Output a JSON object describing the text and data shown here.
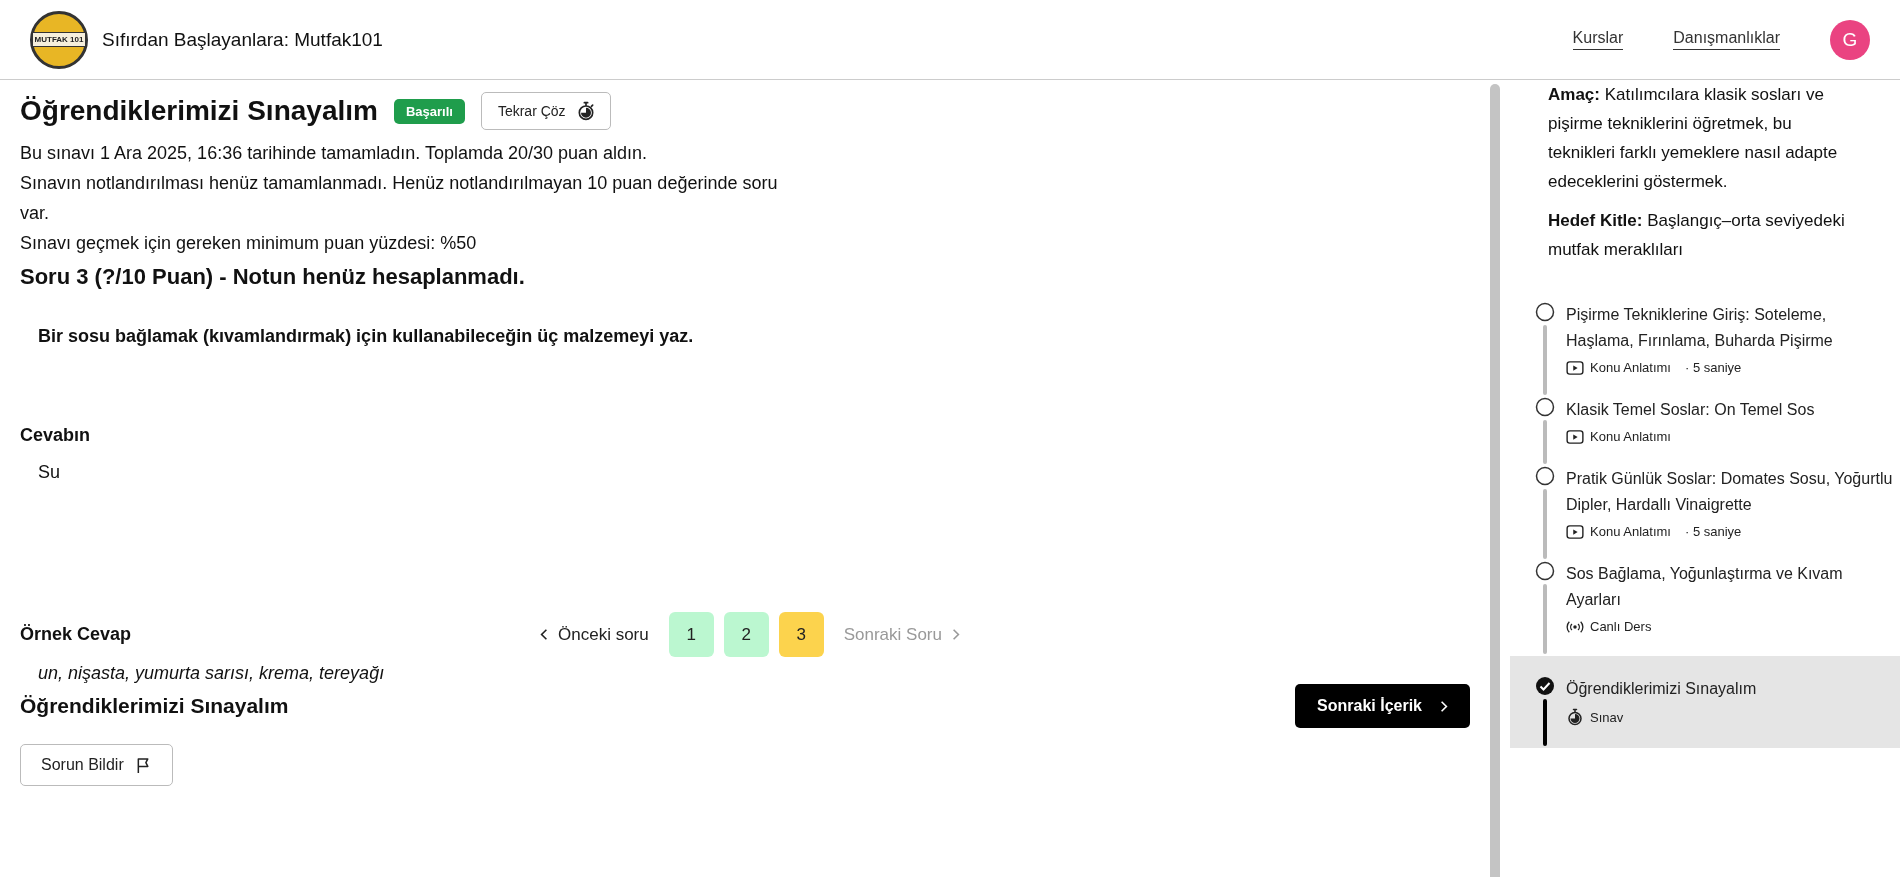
{
  "header": {
    "logo_text": "MUTFAK 101",
    "course_title": "Sıfırdan Başlayanlara: Mutfak101",
    "nav": [
      "Kurslar",
      "Danışmanlıklar"
    ],
    "avatar": "G"
  },
  "quiz": {
    "title": "Öğrendiklerimizi Sınayalım",
    "status_badge": "Başarılı",
    "retry_button": "Tekrar Çöz",
    "summary": [
      "Bu sınavı 1 Ara 2025, 16:36 tarihinde tamamladın. Toplamda 20/30 puan aldın.",
      "Sınavın notlandırılması henüz tamamlanmadı. Henüz notlandırılmayan 10 puan değerinde soru var.",
      "Sınavı geçmek için gereken minimum puan yüzdesi: %50"
    ],
    "question_heading": "Soru 3 (?/10 Puan) - Notun henüz hesaplanmadı.",
    "question": "Bir sosu bağlamak (kıvamlandırmak) için kullanabileceğin üç malzemeyi yaz.",
    "answer_label": "Cevabın",
    "answer": "Su",
    "sample_label": "Örnek Cevap",
    "sample_answer": "un, nişasta, yumurta sarısı, krema, tereyağı",
    "prev": {
      "label": "Önceki soru",
      "disabled": false
    },
    "pages": [
      {
        "label": "1",
        "selected": false
      },
      {
        "label": "2",
        "selected": false
      },
      {
        "label": "3",
        "selected": true
      }
    ],
    "next": {
      "label": "Sonraki Soru",
      "disabled": true
    }
  },
  "footer": {
    "title": "Öğrendiklerimizi Sınayalım",
    "next_content": "Sonraki İçerik",
    "report": "Sorun Bildir"
  },
  "sidebar": {
    "paragraphs": [
      "**Amaç:** Katılımcılara klasik sosları ve pişirme tekniklerini öğretmek, bu teknikleri farklı yemeklere nasıl adapte edeceklerini göstermek.",
      "**Hedef Kitle:** Başlangıç–orta seviyedeki mutfak meraklıları"
    ],
    "items": [
      {
        "title": "Pişirme Tekniklerine Giriş: Soteleme, Haşlama, Fırınlama, Buharda Pişirme",
        "kind": "video",
        "type": "Konu Anlatımı",
        "duration": "· 5 saniye",
        "selected": false
      },
      {
        "title": "Klasik Temel Soslar: On Temel Sos",
        "kind": "video",
        "type": "Konu Anlatımı",
        "selected": false
      },
      {
        "title": "Pratik Günlük Soslar: Domates Sosu, Yoğurtlu Dipler, Hardallı Vinaigrette",
        "kind": "video",
        "type": "Konu Anlatımı",
        "duration": "· 5 saniye",
        "selected": false
      },
      {
        "title": "Sos Bağlama, Yoğunlaştırma ve Kıvam Ayarları",
        "kind": "live",
        "type": "Canlı Ders",
        "selected": false
      },
      {
        "title": "Öğrendiklerimizi Sınayalım",
        "kind": "exam",
        "type": "Sınav",
        "selected": true
      }
    ]
  }
}
